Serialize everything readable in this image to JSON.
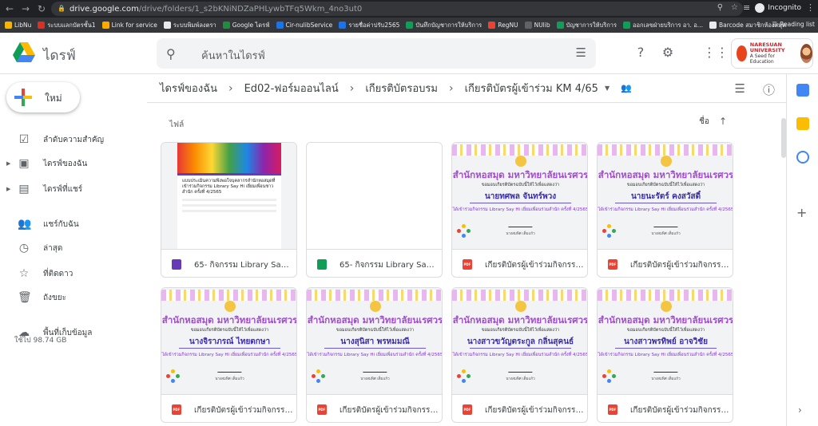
{
  "browser": {
    "url_host": "drive.google.com",
    "url_path": "/drive/folders/1_s2bKNiNDZaPHLywbTFq5Wkm_4no3ut0",
    "incognito_label": "Incognito",
    "reading_list": "Reading list",
    "bookmarks": [
      {
        "label": "LibNu",
        "color": "#f4b400"
      },
      {
        "label": "ระบบแลกบัตรชั้น1",
        "color": "#d93025"
      },
      {
        "label": "Link for service",
        "color": "#f9ab00"
      },
      {
        "label": "ระบบพิมพ์ลงตรา",
        "color": "#e8eaed"
      },
      {
        "label": "Google ไดรฟ์",
        "color": "#1e8e3e"
      },
      {
        "label": "Cir-nulibService",
        "color": "#1a73e8"
      },
      {
        "label": "รายชื่อค่าปรับ2565",
        "color": "#1a73e8"
      },
      {
        "label": "บันทึกบัญชาการให้บริการ",
        "color": "#0f9d58"
      },
      {
        "label": "RegNU",
        "color": "#ea4335"
      },
      {
        "label": "NUlib",
        "color": "#5f6368"
      },
      {
        "label": "บัญชาการให้บริการ",
        "color": "#0f9d58"
      },
      {
        "label": "ออกเลขฝ่ายบริการ อา. อ...",
        "color": "#0f9d58"
      },
      {
        "label": "Barcode สมาชิกห้องสมุด",
        "color": "#e8eaed"
      }
    ]
  },
  "header": {
    "brand": "ไดรฟ์",
    "search_placeholder": "ค้นหาในไดรฟ์",
    "org_name": "NARESUAN UNIVERSITY",
    "org_tagline": "A Seed for Education"
  },
  "sidebar": {
    "new_label": "ใหม่",
    "items": [
      {
        "label": "ลำดับความสำคัญ",
        "icon": "priority-icon"
      },
      {
        "label": "ไดรฟ์ของฉัน",
        "icon": "my-drive-icon"
      },
      {
        "label": "ไดรฟ์ที่แชร์",
        "icon": "shared-drives-icon"
      },
      {
        "label": "แชร์กับฉัน",
        "icon": "shared-with-me-icon"
      },
      {
        "label": "ล่าสุด",
        "icon": "recent-icon"
      },
      {
        "label": "ที่ติดดาว",
        "icon": "starred-icon"
      },
      {
        "label": "ถังขยะ",
        "icon": "trash-icon"
      },
      {
        "label": "พื้นที่เก็บข้อมูล",
        "icon": "storage-icon"
      }
    ],
    "storage_used": "ใช้ไป 98.74 GB"
  },
  "breadcrumb": [
    "ไดรฟ์ของฉัน",
    "Ed02-ฟอร์มออนไลน์",
    "เกียรติบัตรอบรม",
    "เกียรติบัตรผู้เข้าร่วม KM 4/65"
  ],
  "main": {
    "section_label": "ไฟล์",
    "sort_label": "ชื่อ"
  },
  "files": [
    {
      "name": "65- กิจกรรม Library Say H...",
      "type": "forms",
      "thumb": "form"
    },
    {
      "name": "65- กิจกรรม Library Say H...",
      "type": "sheets",
      "thumb": "blank"
    },
    {
      "name": "เกียรติบัตรผู้เข้าร่วมกิจกรรม...",
      "type": "pdf",
      "thumb": "cert",
      "recipient": "นายทศพล จันทร์พวง"
    },
    {
      "name": "เกียรติบัตรผู้เข้าร่วมกิจกรรม...",
      "type": "pdf",
      "thumb": "cert",
      "recipient": "นายนะรัตร์ คงสวัสดิ์"
    },
    {
      "name": "เกียรติบัตรผู้เข้าร่วมกิจกรรม...",
      "type": "pdf",
      "thumb": "cert",
      "recipient": "นางจิราภรณ์ ไทยตกษา"
    },
    {
      "name": "เกียรติบัตรผู้เข้าร่วมกิจกรรม...",
      "type": "pdf",
      "thumb": "cert",
      "recipient": "นางสุนิสา พรหมมณี"
    },
    {
      "name": "เกียรติบัตรผู้เข้าร่วมกิจกรรม...",
      "type": "pdf",
      "thumb": "cert",
      "recipient": "นางสาวขวัญตระกูล กลิ่นสุคนธ์"
    },
    {
      "name": "เกียรติบัตรผู้เข้าร่วมกิจกรรม...",
      "type": "pdf",
      "thumb": "cert",
      "recipient": "นางสาวพรทิพย์ อาจวิชัย"
    }
  ],
  "certificate": {
    "org_title": "สำนักหอสมุด มหาวิทยาลัยนเรศวร",
    "subtitle": "ขอมอบเกียรติบัตรฉบับนี้ให้ไว้เพื่อแสดงว่า",
    "event": "ได้เข้าร่วมกิจกรรม Library Say Hi เยี่ยมเพื่อนร่วมสำนัก ครั้งที่ 4/2565",
    "signer": "นางสมพิศ เต็มแก้ว"
  },
  "form_preview": {
    "title": "แบบประเมินความพึงพอใจบุคลากรสำนักหอสมุดที่เข้าร่วมกิจกรรม Library Say Hi เยี่ยมเพื่อนชาวสำนัก ครั้งที่ 4/2565"
  },
  "colors": {
    "forms": "#673ab7",
    "sheets": "#0f9d58",
    "pdf": "#ea4335",
    "cert_title": "#a24bd0",
    "cert_name": "#3b2bb0"
  }
}
